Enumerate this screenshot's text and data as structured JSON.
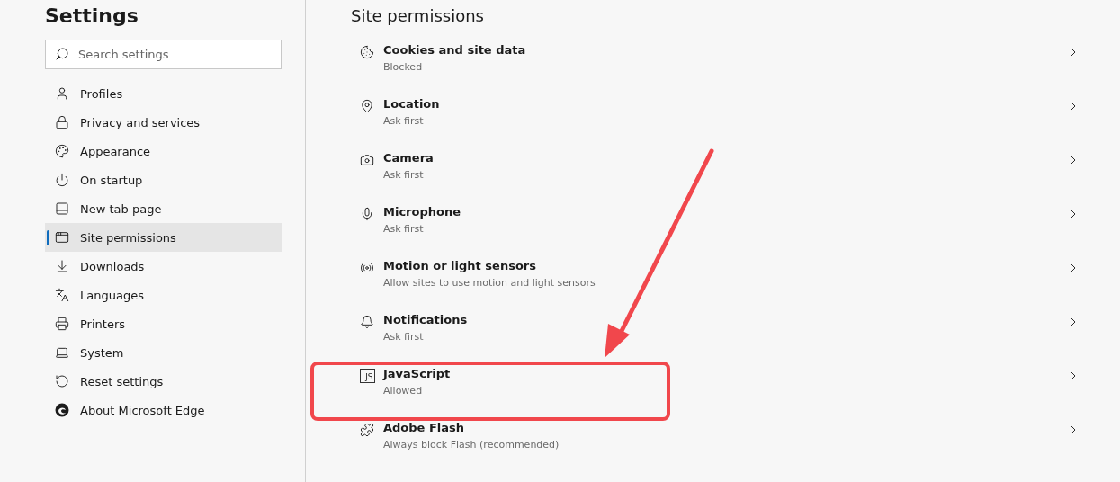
{
  "sidebar": {
    "title": "Settings",
    "search": {
      "placeholder": "Search settings"
    },
    "items": [
      {
        "label": "Profiles",
        "selected": false
      },
      {
        "label": "Privacy and services",
        "selected": false
      },
      {
        "label": "Appearance",
        "selected": false
      },
      {
        "label": "On startup",
        "selected": false
      },
      {
        "label": "New tab page",
        "selected": false
      },
      {
        "label": "Site permissions",
        "selected": true
      },
      {
        "label": "Downloads",
        "selected": false
      },
      {
        "label": "Languages",
        "selected": false
      },
      {
        "label": "Printers",
        "selected": false
      },
      {
        "label": "System",
        "selected": false
      },
      {
        "label": "Reset settings",
        "selected": false
      },
      {
        "label": "About Microsoft Edge",
        "selected": false
      }
    ]
  },
  "main": {
    "title": "Site permissions",
    "permissions": [
      {
        "name": "Cookies and site data",
        "status": "Blocked",
        "highlighted": false
      },
      {
        "name": "Location",
        "status": "Ask first",
        "highlighted": false
      },
      {
        "name": "Camera",
        "status": "Ask first",
        "highlighted": false
      },
      {
        "name": "Microphone",
        "status": "Ask first",
        "highlighted": false
      },
      {
        "name": "Motion or light sensors",
        "status": "Allow sites to use motion and light sensors",
        "highlighted": false
      },
      {
        "name": "Notifications",
        "status": "Ask first",
        "highlighted": false
      },
      {
        "name": "JavaScript",
        "status": "Allowed",
        "highlighted": true,
        "icon_text": "JS"
      },
      {
        "name": "Adobe Flash",
        "status": "Always block Flash (recommended)",
        "highlighted": false
      }
    ]
  }
}
